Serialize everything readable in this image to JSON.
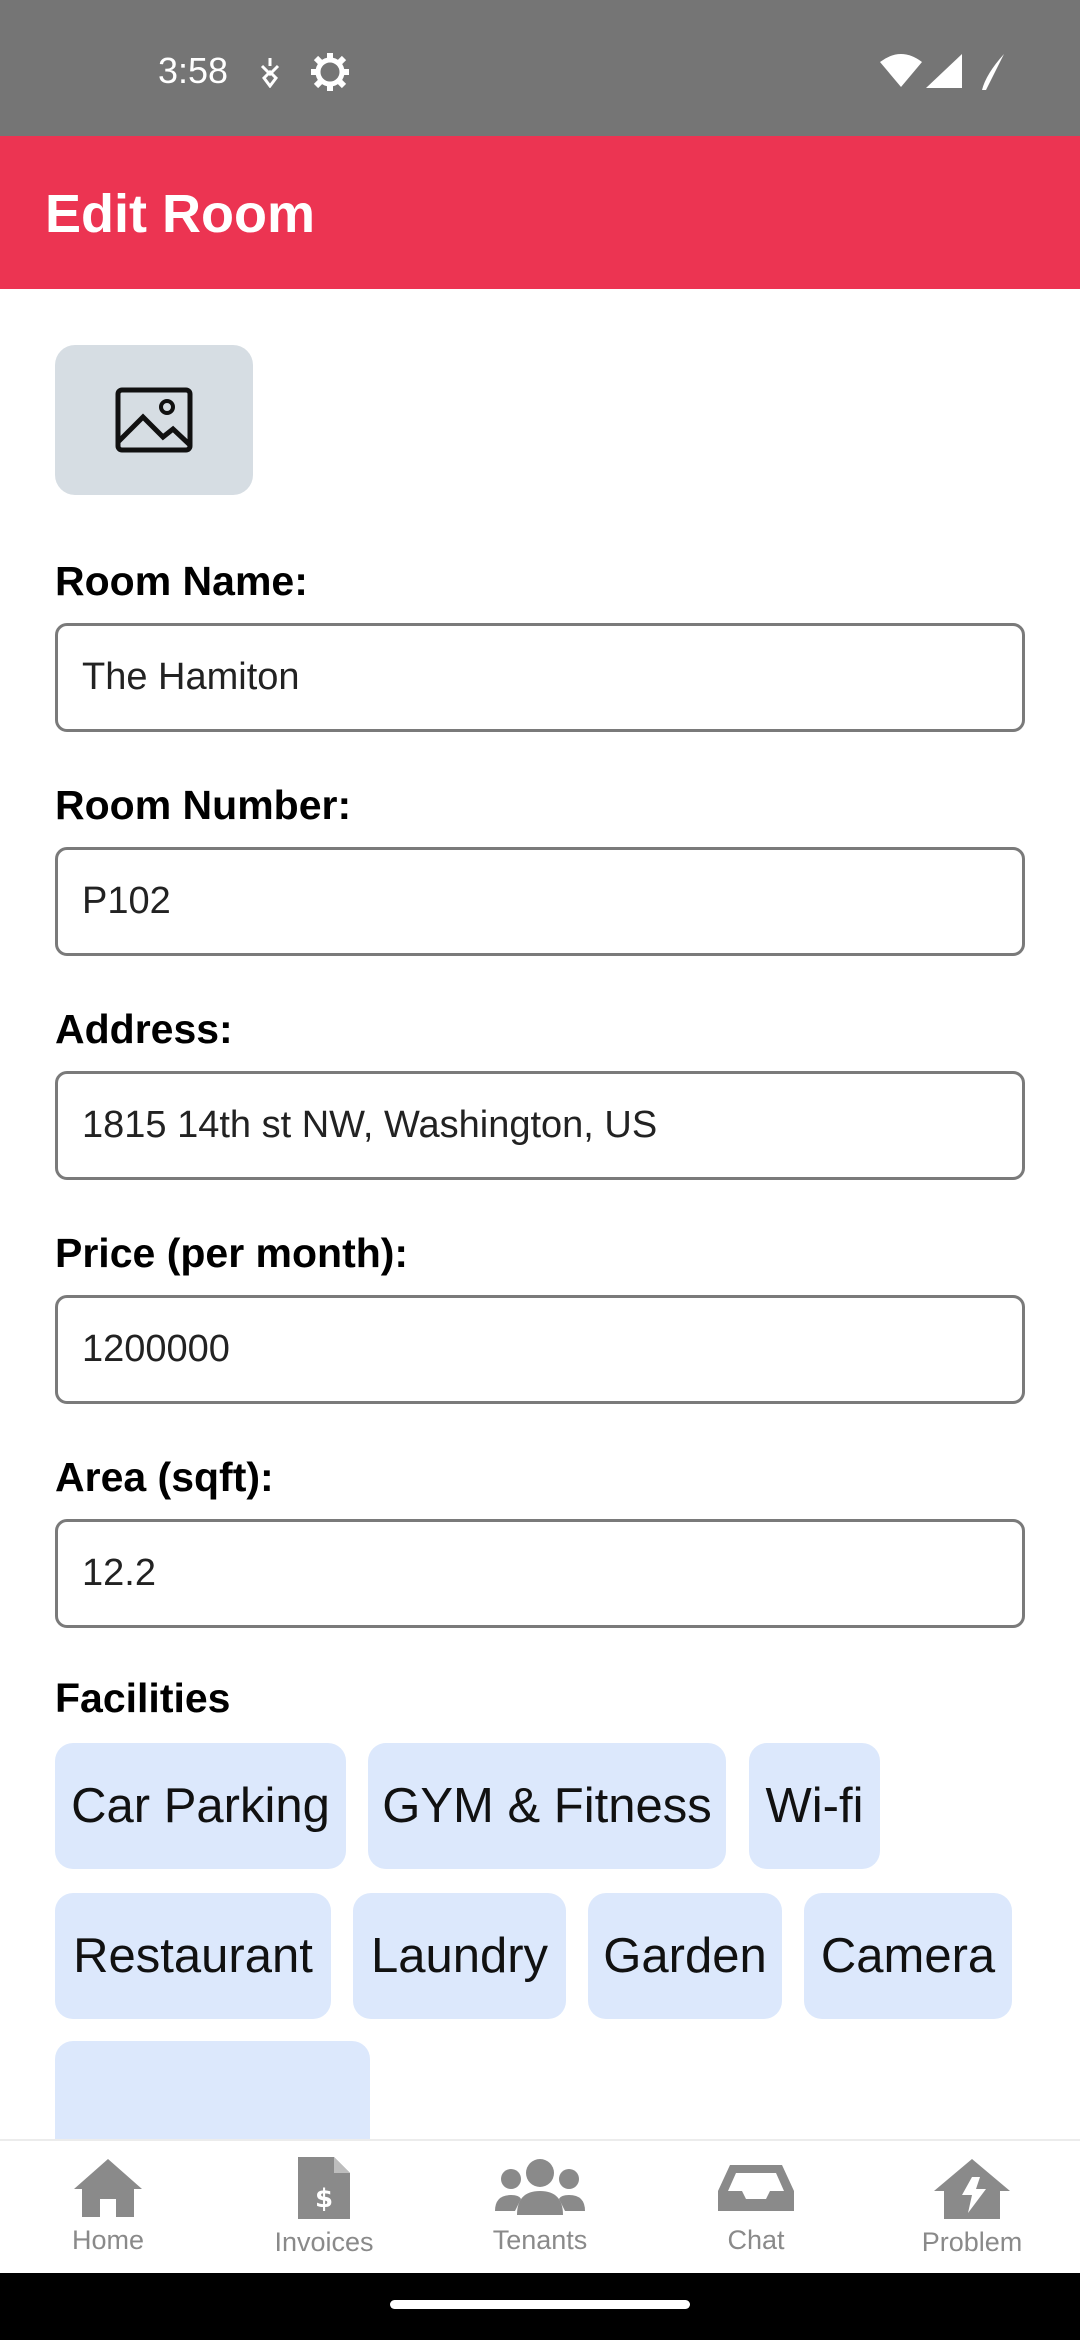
{
  "status_bar": {
    "time": "3:58",
    "icons": [
      "dnd-icon",
      "settings-gear-icon",
      "wifi-icon",
      "signal-icon",
      "battery-icon"
    ]
  },
  "app_bar": {
    "title": "Edit Room",
    "color": "#ec3452"
  },
  "image_picker": {
    "icon": "image-icon"
  },
  "form": {
    "room_name": {
      "label": "Room Name:",
      "value": "The Hamiton"
    },
    "room_number": {
      "label": "Room Number:",
      "value": "P102"
    },
    "address": {
      "label": "Address:",
      "value": "1815 14th st NW, Washington, US"
    },
    "price": {
      "label": "Price (per month):",
      "value": "1200000"
    },
    "area": {
      "label": "Area (sqft):",
      "value": "12.2"
    }
  },
  "facilities": {
    "title": "Facilities",
    "items": [
      "Car Parking",
      "GYM & Fitness",
      "Wi-fi",
      "Restaurant",
      "Laundry",
      "Garden",
      "Camera",
      ""
    ]
  },
  "bottom_nav": {
    "items": [
      {
        "label": "Home",
        "icon": "home-icon"
      },
      {
        "label": "Invoices",
        "icon": "invoice-icon"
      },
      {
        "label": "Tenants",
        "icon": "tenants-icon"
      },
      {
        "label": "Chat",
        "icon": "inbox-icon"
      },
      {
        "label": "Problem",
        "icon": "problem-house-icon"
      }
    ]
  }
}
